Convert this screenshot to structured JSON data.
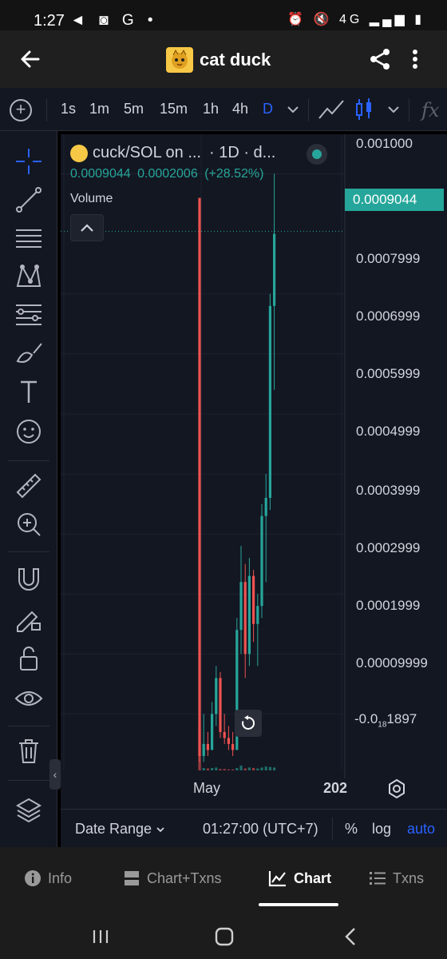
{
  "status_bar": {
    "time": "1:27",
    "left_icons": [
      "telegram-icon",
      "instagram-icon",
      "google-icon",
      "dot-icon"
    ],
    "left_glyphs": "◄ ◙ G •",
    "right_icons": [
      "alarm-icon",
      "mute-icon",
      "4g-icon",
      "signal-icon",
      "battery-icon"
    ],
    "right_glyphs": "⏰ 🔇 4G ▂▄▆ ▮"
  },
  "header": {
    "title": "cat duck",
    "icons": [
      "back-arrow-icon",
      "token-logo",
      "share-icon",
      "more-vertical-icon"
    ]
  },
  "toolbar": {
    "timeframes": [
      "1s",
      "1m",
      "5m",
      "15m",
      "1h",
      "4h",
      "D"
    ],
    "active_timeframe": "D",
    "fx_label": "fx",
    "icons": [
      "add-circle-icon",
      "chevron-down-icon",
      "line-chart-icon",
      "candles-icon",
      "chevron-down-icon",
      "indicators-icon"
    ]
  },
  "left_tools": [
    "crosshair-icon",
    "trend-line-icon",
    "horizontal-lines-icon",
    "pattern-icon",
    "fib-icon",
    "brush-icon",
    "text-icon",
    "emoji-icon",
    "ruler-icon",
    "zoom-in-icon",
    "magnet-icon",
    "lock-draw-icon",
    "unlock-icon",
    "eye-icon",
    "trash-icon",
    "layers-icon"
  ],
  "legend": {
    "symbol": "cuck/SOL on ...",
    "interval": "· 1D · d...",
    "close": "0.0009044",
    "change": "0.0002006",
    "change_pct": "(+28.52%)",
    "volume_label": "Volume"
  },
  "price_axis": {
    "labels": [
      "0.001000",
      "0.0007999",
      "0.0006999",
      "0.0005999",
      "0.0004999",
      "0.0003999",
      "0.0002999",
      "0.0001999",
      "0.00009999"
    ],
    "last_label_prefix": "-0.0",
    "last_label_sub": "18",
    "last_label_suffix": "1897",
    "current_price": "0.0009044"
  },
  "time_axis": {
    "labels": [
      "May",
      "202"
    ]
  },
  "chart_data": {
    "type": "candlestick",
    "symbol": "cuck/SOL",
    "interval": "1D",
    "y_ticks": [
      0.001,
      0.0007999,
      0.0006999,
      0.0005999,
      0.0004999,
      0.0003999,
      0.0002999,
      0.0001999,
      9.999e-05
    ],
    "ylim": [
      -1e-05,
      0.00105
    ],
    "x_ticks": [
      "May",
      "202"
    ],
    "last_price": 0.0009044,
    "colors": {
      "up": "#26a69a",
      "down": "#ef5350"
    },
    "candles_sampled": [
      [
        0.00096,
        0.00096,
        2e-05,
        3e-05
      ],
      [
        3e-05,
        0.0001,
        2e-05,
        5e-05
      ],
      [
        5e-05,
        7e-05,
        3e-05,
        4e-05
      ],
      [
        4e-05,
        0.00012,
        4e-05,
        0.0001
      ],
      [
        0.0001,
        0.00018,
        8e-05,
        0.00016
      ],
      [
        0.00016,
        0.00017,
        6e-05,
        7e-05
      ],
      [
        7e-05,
        0.0001,
        5e-05,
        6e-05
      ],
      [
        6e-05,
        8e-05,
        4e-05,
        5e-05
      ],
      [
        5e-05,
        7e-05,
        3e-05,
        4e-05
      ],
      [
        4e-05,
        0.00026,
        4e-05,
        0.00024
      ],
      [
        0.00024,
        0.00038,
        0.0002,
        0.00032
      ],
      [
        0.00032,
        0.00035,
        0.00016,
        0.0002
      ],
      [
        0.0002,
        0.00036,
        0.00018,
        0.00033
      ],
      [
        0.00033,
        0.00034,
        0.00022,
        0.00025
      ],
      [
        0.00025,
        0.0003,
        0.00018,
        0.00028
      ],
      [
        0.00028,
        0.00045,
        0.00026,
        0.00043
      ],
      [
        0.00043,
        0.0005,
        0.00032,
        0.00046
      ],
      [
        0.00046,
        0.0008,
        0.00044,
        0.00078
      ],
      [
        0.00078,
        0.001,
        0.00064,
        0.0009
      ]
    ],
    "volume_sampled": [
      0.9,
      0.05,
      0.04,
      0.05,
      0.06,
      0.03,
      0.03,
      0.02,
      0.02,
      0.05,
      0.1,
      0.04,
      0.06,
      0.05,
      0.04,
      0.06,
      0.08,
      0.07,
      0.06
    ]
  },
  "chart_footer": {
    "date_range": "Date Range",
    "clock": "01:27:00 (UTC+7)",
    "percent": "%",
    "log": "log",
    "auto": "auto"
  },
  "app_tabs": [
    {
      "label": "Info",
      "icon": "info-icon",
      "active": false
    },
    {
      "label": "Chart+Txns",
      "icon": "chart-txns-icon",
      "active": false
    },
    {
      "label": "Chart",
      "icon": "chart-icon",
      "active": true
    },
    {
      "label": "Txns",
      "icon": "list-icon",
      "active": false
    }
  ],
  "android_nav": [
    "recents-icon",
    "home-icon",
    "back-icon"
  ]
}
